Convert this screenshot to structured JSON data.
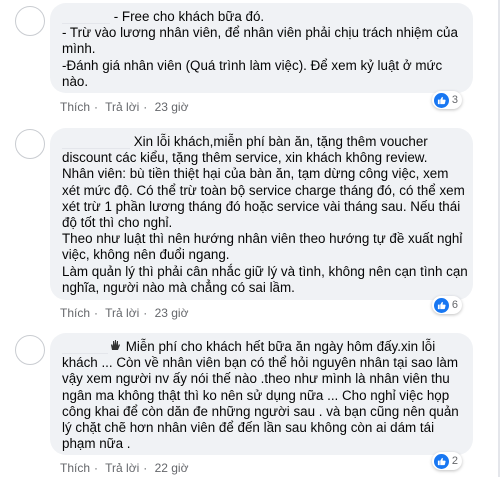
{
  "comments": [
    {
      "lines": [
        "- Free cho khách bữa đó.",
        "- Trừ vào lương nhân viên, để nhân viên phải chịu trách nhiệm của",
        "mình.",
        "-Đánh giá nhân viên (Quá trình làm việc). Để xem kỷ luật ở mức",
        "nào."
      ],
      "like_label": "Thích",
      "reply_label": "Trả lời",
      "time": "23 giờ",
      "reaction_count": "3"
    },
    {
      "lines": [
        "Xin lỗi khách,miễn phí bàn ăn, tặng thêm voucher",
        "discount các kiểu, tặng thêm service, xin khách không review.",
        "Nhân viên: bù tiền thiệt hại của bàn ăn, tạm dừng công việc, xem",
        "xét mức độ. Có thể trừ toàn bộ service charge tháng đó, có thể xem",
        "xét trừ 1 phần lương tháng đó hoặc service vài tháng sau. Nếu thái",
        "độ tốt thì cho nghỉ.",
        "Theo như luật thì nên hướng nhân viên theo hướng tự đề xuất nghỉ",
        "việc, không nên đuổi ngang.",
        "Làm quản lý thì phải cân nhắc giữ lý và tình, không nên cạn tình cạn",
        "nghĩa, người nào mà chẳng có sai lầm."
      ],
      "like_label": "Thích",
      "reply_label": "Trả lời",
      "time": "23 giờ",
      "reaction_count": "6"
    },
    {
      "lines": [
        "Miễn phí cho khách hết bữa ăn ngày hôm đấy.xin lỗi",
        "khách ... Còn về nhân viên bạn có thể hỏi nguyên nhân tại sao làm",
        "vậy xem người nv ấy nói thế nào .theo như mình là nhân viên thu",
        "ngân ma không thật thì ko nên sử dụng nữa ... Cho nghỉ việc họp",
        "công khai để còn dăn đe những người sau . và bạn cũng nên quản",
        "lý chặt chẽ hơn nhân viên để đến lần sau không còn ai dám tái",
        "phạm nữa ."
      ],
      "like_label": "Thích",
      "reply_label": "Trả lời",
      "time": "22 giờ",
      "reaction_count": "2"
    }
  ],
  "colors": {
    "bubble": "#f0f2f5",
    "like_blue": "#1877f2",
    "meta_text": "#65676b"
  },
  "icons": [
    "like-icon",
    "waving-hand-icon"
  ]
}
